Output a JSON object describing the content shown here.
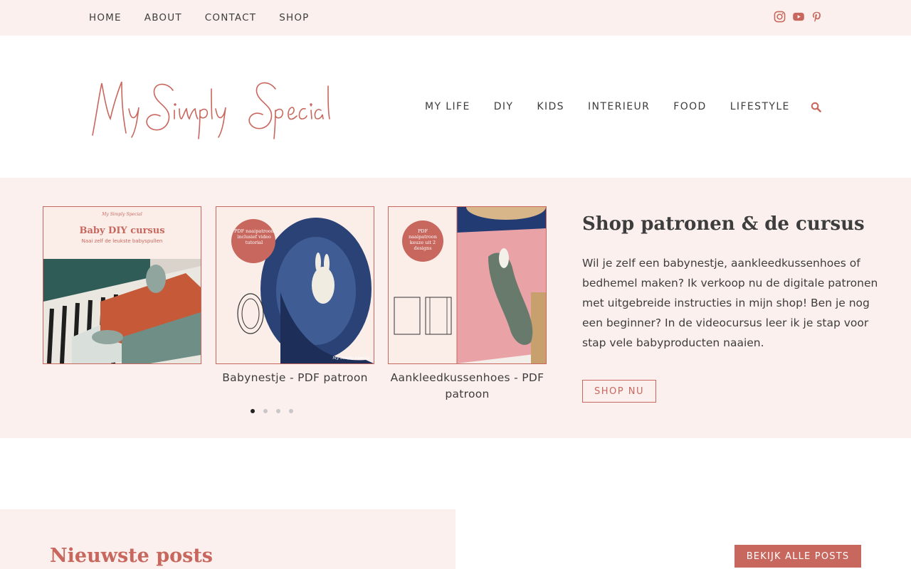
{
  "topnav": {
    "items": [
      "HOME",
      "ABOUT",
      "CONTACT",
      "SHOP"
    ]
  },
  "social": {
    "icons": [
      "instagram-icon",
      "youtube-icon",
      "pinterest-icon"
    ],
    "color": "#c8675d"
  },
  "logo": {
    "text": "My Simply Special"
  },
  "mainnav": {
    "items": [
      "MY LIFE",
      "DIY",
      "KIDS",
      "INTERIEUR",
      "FOOD",
      "LIFESTYLE"
    ]
  },
  "colors": {
    "accent": "#c8675d",
    "blush": "#fbf0ed",
    "text": "#3d3d3d"
  },
  "carousel": {
    "cards": [
      {
        "image_title": "Baby DIY cursus",
        "image_subtitle": "Naai zelf de leukste babyspullen",
        "image_logo": "My Simply Special",
        "caption": ""
      },
      {
        "badge": "PDF naaipatroon inclusief video tutorial",
        "caption": "Babynestje - PDF patroon",
        "image_logo": "My Simply Special"
      },
      {
        "badge": "PDF naaipatroon keuze uit 2 designs",
        "caption": "Aankleedkussenhoes - PDF patroon"
      }
    ],
    "dots": 4,
    "active_dot": 0
  },
  "shop": {
    "title": "Shop patronen & de cursus",
    "text": "Wil je zelf een babynestje, aankleedkussenhoes of bedhemel maken? Ik verkoop nu de digitale patronen met uitgebreide instructies in mijn shop! Ben je nog een beginner? In de videocursus leer ik je stap voor stap vele babyproducten naaien.",
    "button": "SHOP NU"
  },
  "news": {
    "title": "Nieuwste posts",
    "button": "BEKIJK ALLE POSTS"
  }
}
